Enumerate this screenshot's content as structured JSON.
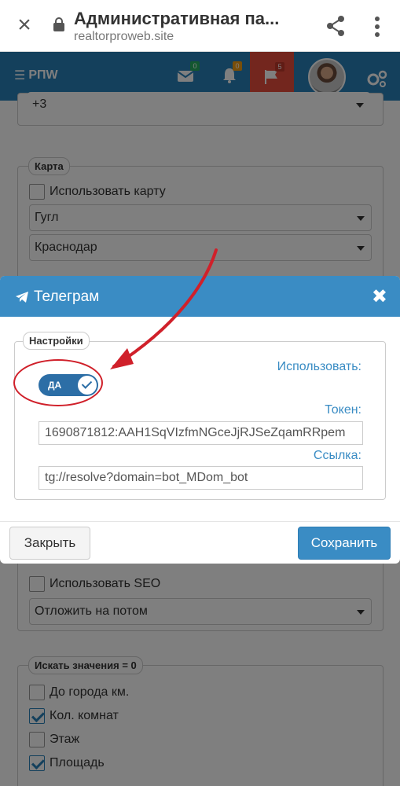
{
  "browser": {
    "title": "Административная па...",
    "host": "realtorproweb.site"
  },
  "header": {
    "logo": "РПW",
    "mail_count": "0",
    "bell_count": "0",
    "flag_count": "5"
  },
  "background": {
    "phone_prefix": "+3",
    "map_legend": "Карта",
    "use_map_label": "Использовать карту",
    "map_provider": "Гугл",
    "map_city": "Краснодар",
    "use_seo_label": "Использовать SEO",
    "seo_mode": "Отложить на потом",
    "search_legend": "Искать значения = 0",
    "search_items": [
      {
        "label": "До города км.",
        "checked": false
      },
      {
        "label": "Кол. комнат",
        "checked": true
      },
      {
        "label": "Этаж",
        "checked": false
      },
      {
        "label": "Площадь",
        "checked": true
      }
    ]
  },
  "modal": {
    "title": "Телеграм",
    "settings_legend": "Настройки",
    "use_label": "Использовать:",
    "toggle_text": "ДА",
    "token_label": "Токен:",
    "token_value": "1690871812:AAH1SqVIzfmNGceJjRJSeZqamRRpem",
    "link_label": "Ссылка:",
    "link_value": "tg://resolve?domain=bot_MDom_bot",
    "close_button": "Закрыть",
    "save_button": "Сохранить"
  },
  "colors": {
    "header": "#2980b9",
    "modal_header": "#3a8cc4",
    "flag_active": "#e74c3c",
    "annotation": "#d0202a"
  }
}
